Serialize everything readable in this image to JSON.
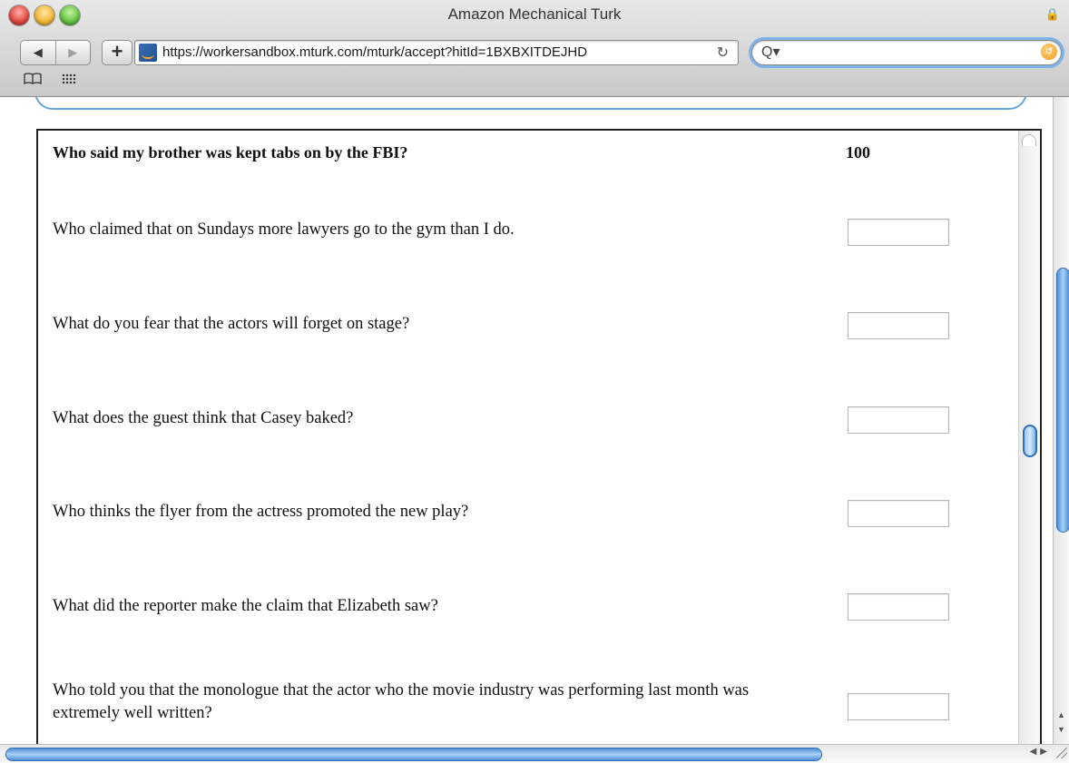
{
  "window": {
    "title": "Amazon Mechanical Turk"
  },
  "toolbar": {
    "back_glyph": "◀",
    "forward_glyph": "▶",
    "add_glyph": "+",
    "url": "https://workersandbox.mturk.com/mturk/accept?hitId=1BXBXITDEJHD",
    "reload_glyph": "↻",
    "search_value": "",
    "search_glyph": "Q▾"
  },
  "bookmarks": {
    "book_glyph": "📖"
  },
  "hit": {
    "header_question": "Who said my brother was kept tabs on by the FBI?",
    "header_score": "100",
    "questions": [
      {
        "text": "Who claimed that on Sundays more lawyers go to the gym than I do.",
        "answer": ""
      },
      {
        "text": "What do you fear that the actors will forget on stage?",
        "answer": ""
      },
      {
        "text": "What does the guest think that Casey baked?",
        "answer": ""
      },
      {
        "text": "Who thinks the flyer from the actress promoted the new play?",
        "answer": ""
      },
      {
        "text": "What did the reporter make the claim that Elizabeth saw?",
        "answer": ""
      },
      {
        "text": "Who told you that the monologue that the actor who the movie industry was performing last month was extremely well written?",
        "answer": ""
      }
    ]
  },
  "colors": {
    "accent": "#4f8fd6",
    "frame_border": "#222222"
  }
}
